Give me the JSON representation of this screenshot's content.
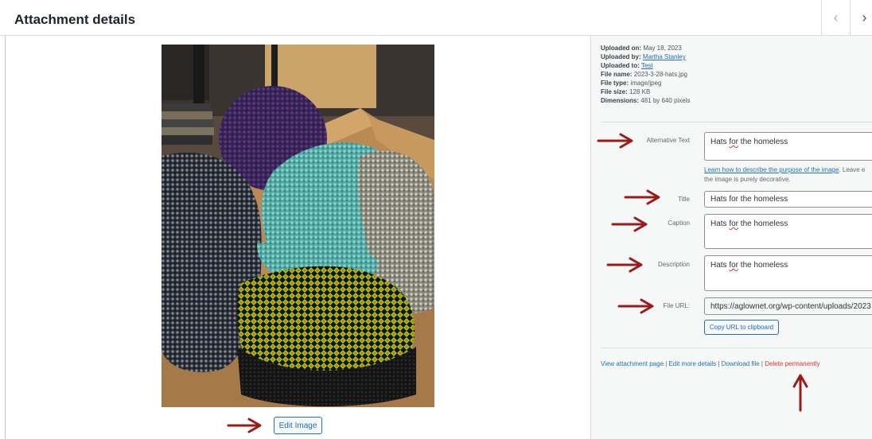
{
  "header": {
    "title": "Attachment details",
    "prev_icon": "‹",
    "next_icon": "›"
  },
  "image": {
    "edit_label": "Edit Image"
  },
  "details": {
    "uploaded_on_label": "Uploaded on:",
    "uploaded_on": "May 18, 2023",
    "uploaded_by_label": "Uploaded by:",
    "uploaded_by": "Martha Stanley",
    "uploaded_to_label": "Uploaded to:",
    "uploaded_to": "Test",
    "file_name_label": "File name:",
    "file_name": "2023-3-28-hats.jpg",
    "file_type_label": "File type:",
    "file_type": "image/jpeg",
    "file_size_label": "File size:",
    "file_size": "128 KB",
    "dimensions_label": "Dimensions:",
    "dimensions": "481 by 640 pixels"
  },
  "fields": {
    "alt_label": "Alternative Text",
    "alt_value_pre": "Hats ",
    "alt_value_sq": "for",
    "alt_value_post": " the homeless",
    "help_link": "Learn how to describe the purpose of the image",
    "help_text_1": ". Leave e",
    "help_text_2": "the image is purely decorative.",
    "title_label": "Title",
    "title_value": "Hats for the homeless",
    "caption_label": "Caption",
    "caption_value_pre": "Hats ",
    "caption_value_sq": "for",
    "caption_value_post": " the homeless",
    "description_label": "Description",
    "description_value_pre": "Hats ",
    "description_value_sq": "for",
    "description_value_post": " the homeless",
    "url_label": "File URL:",
    "url_value": "https://aglownet.org/wp-content/uploads/2023",
    "copy_label": "Copy URL to clipboard"
  },
  "actions": {
    "view": "View attachment page",
    "edit_more": "Edit more details",
    "download": "Download file",
    "delete": "Delete permanently",
    "separator": " | "
  },
  "colors": {
    "annotation_arrow": "#9b1b1b",
    "link": "#2271b1",
    "danger": "#d63638"
  }
}
